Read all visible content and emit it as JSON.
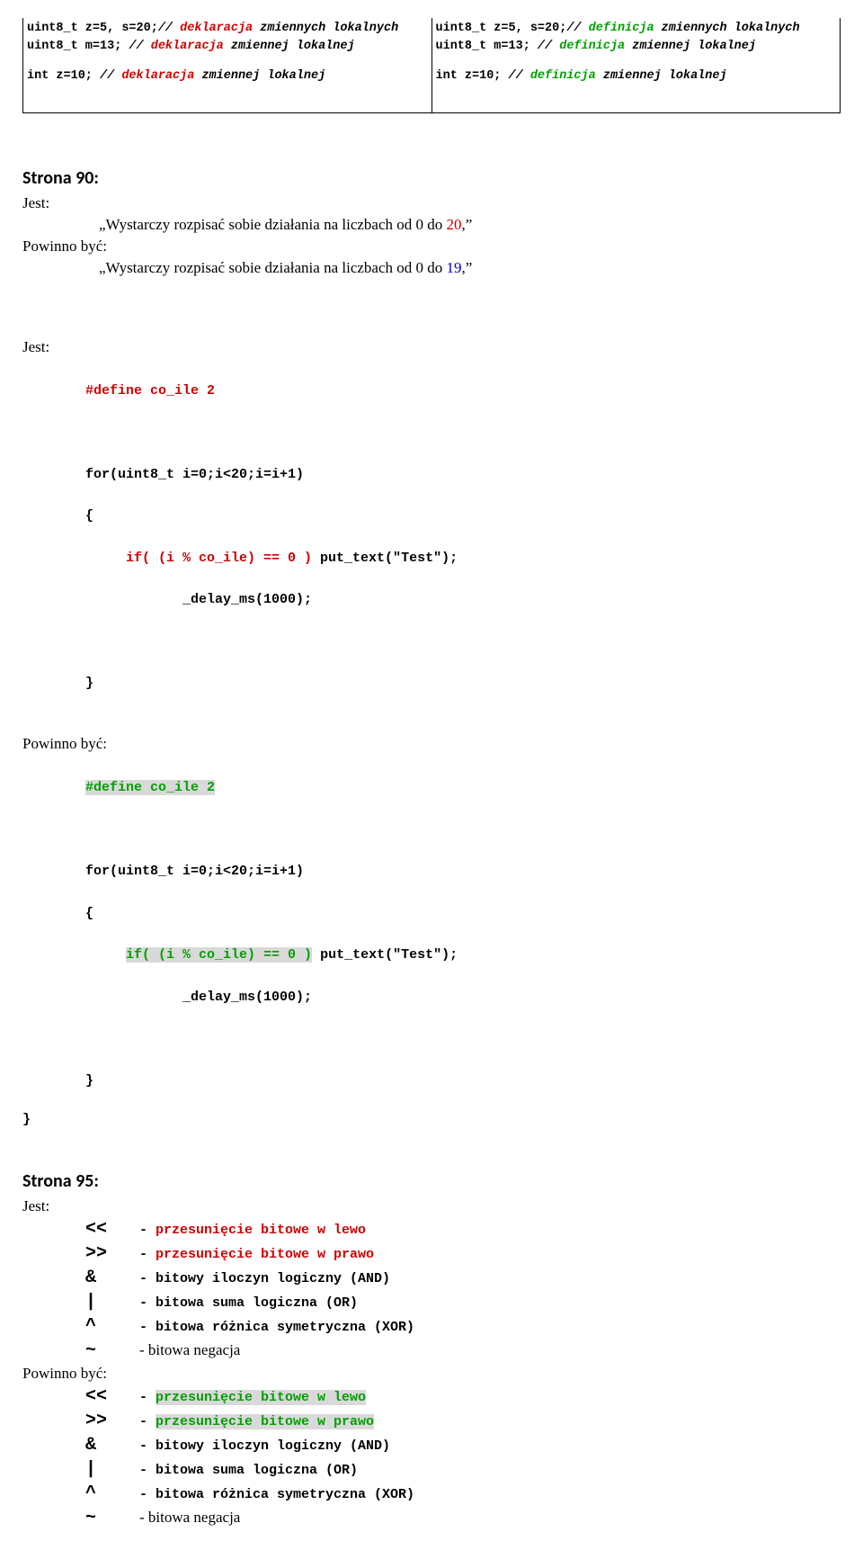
{
  "top": {
    "left": {
      "l1a": "uint8_t z=5, s=20;",
      "l1c": "// ",
      "l1w": "deklaracja",
      "l1r": " zmiennych lokalnych",
      "l2a": "uint8_t m=13;",
      "l2c": "   // ",
      "l2w": "deklaracja",
      "l2r": " zmiennej lokalnej",
      "l3a": "int z=10; ",
      "l3c": "// ",
      "l3w": "deklaracja",
      "l3r": " zmiennej lokalnej"
    },
    "right": {
      "l1a": "uint8_t z=5, s=20;",
      "l1c": "// ",
      "l1w": "definicja",
      "l1r": " zmiennych lokalnych",
      "l2a": "uint8_t m=13;",
      "l2c": "   // ",
      "l2w": "definicja",
      "l2r": " zmiennej lokalnej",
      "l3a": "int z=10; ",
      "l3c": "// ",
      "l3w": "definicja",
      "l3r": " zmiennej lokalnej"
    }
  },
  "s90": {
    "heading": "Strona 90:",
    "jest": "Jest:",
    "powinno": "Powinno być:",
    "q1a": "„Wystarczy rozpisać sobie działania na liczbach od 0 do ",
    "q1n": "20",
    "q1b": ",”",
    "q2a": "„Wystarczy rozpisać sobie działania na liczbach od 0 do ",
    "q2n": "19",
    "q2b": ",”"
  },
  "code1": {
    "jest": "Jest:",
    "define": "#define co_ile 2",
    "for": "for(uint8_t i=0;i<20;i=i+1)",
    "ob": "{",
    "ifp": "     if( (i % co_ile) == 0 )",
    "ifr": " put_text(\"Test\");",
    "delay": "            _delay_ms(1000);",
    "cb": "}",
    "cb2": "}"
  },
  "code2": {
    "powinno": "Powinno być:",
    "define": "#define co_ile 2",
    "for": "for(uint8_t i=0;i<20;i=i+1)",
    "ob": "{",
    "ifp": "if( (i % co_ile) == 0 )",
    "ifr": " put_text(\"Test\");",
    "delay": "            _delay_ms(1000);",
    "cb": "}",
    "cb2": "}"
  },
  "s95": {
    "heading": "Strona 95:",
    "jest": "Jest:",
    "powinno": "Powinno być:",
    "ops1": [
      {
        "sym": "<<",
        "dash": "-",
        "desc": "przesunięcie bitowe w lewo",
        "cls": "red"
      },
      {
        "sym": ">>",
        "dash": "-",
        "desc": "przesunięcie bitowe w prawo",
        "cls": "red"
      },
      {
        "sym": "&",
        "dash": "-",
        "desc": "bitowy iloczyn logiczny (AND)",
        "cls": ""
      },
      {
        "sym": "|",
        "dash": "-",
        "desc": "bitowa suma logiczna (OR)",
        "cls": ""
      },
      {
        "sym": "^",
        "dash": "-",
        "desc": "bitowa różnica symetryczna (XOR)",
        "cls": ""
      }
    ],
    "neg1": {
      "sym": "~",
      "dash": "",
      "desc": "- bitowa negacja"
    },
    "ops2": [
      {
        "sym": "<<",
        "dash": "-",
        "desc": "przesunięcie bitowe w lewo",
        "cls": "green hl"
      },
      {
        "sym": ">>",
        "dash": "-",
        "desc": "przesunięcie bitowe w prawo",
        "cls": "green hl"
      },
      {
        "sym": "&",
        "dash": "-",
        "desc": "bitowy iloczyn logiczny (AND)",
        "cls": ""
      },
      {
        "sym": "|",
        "dash": "-",
        "desc": "bitowa suma logiczna (OR)",
        "cls": ""
      },
      {
        "sym": "^",
        "dash": "-",
        "desc": "bitowa różnica symetryczna (XOR)",
        "cls": ""
      }
    ],
    "neg2": {
      "sym": "~",
      "dash": "",
      "desc": "- bitowa negacja"
    }
  }
}
